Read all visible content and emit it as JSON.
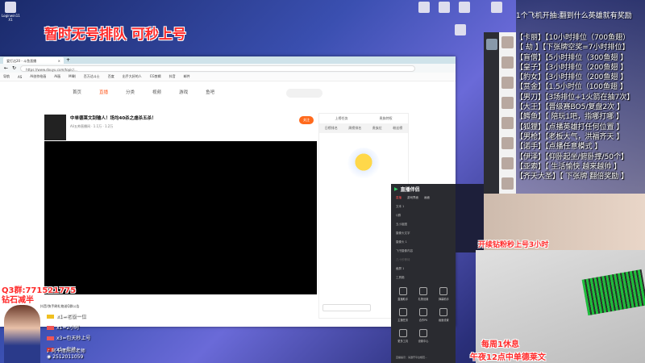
{
  "overlay_title": "暂时无号排队 可秒上号",
  "desktop_icons": [
    "Loginwin11 X1",
    "",
    "",
    "",
    "",
    "",
    "",
    "",
    "",
    "",
    ""
  ],
  "browser": {
    "tab_title": "爱打达20 - 斗鱼直播",
    "url": "https://www.douyu.com/topic/...",
    "bookmarks": [
      "导航",
      "AS",
      "AI创作绘画",
      "AI画",
      "MI刷",
      "百万达斗士",
      "百度",
      "出手大好的人",
      "CG剪辑",
      "抖音",
      "邮件"
    ],
    "nav": [
      "首页",
      "直播",
      "分类",
      "视频",
      "游戏",
      "鱼吧"
    ],
    "stream_title": "中单德莱文刮输人！场均40杀之虐杀五杀！",
    "stream_meta": "Ali五帅直播间 · 1.1万 · 1.2万",
    "follow_label": "关注",
    "chat_tabs_top": [
      "上榜任务",
      "贵族特权"
    ],
    "chat_tabs": [
      "日榜排名",
      "周榜排名",
      "贵族位",
      "粉丝榜"
    ]
  },
  "overlay_list": {
    "title": "1个飞机开抽:翻到什么英雄就有奖励",
    "items": [
      "【卡丽】【10小时排位（700鱼翅）",
      "【 劫 】【下张牌空奖=7小时排位】",
      "【盲僧】【5小时排位（300鱼翅 】",
      "【皇子】【3小时排位（200鱼翅 】",
      "【豹女】【3小时排位（200鱼翅 】",
      "【赏金】【1.5小时位（100鱼翅 】",
      "【男刀】【3场排位+1火箭在抽7次】",
      "【大王】【晋级赛BO5/复盘2次 】",
      "【鳄鱼】【 陪玩1吧，指哪打哪 】",
      "【狐狸】【点播英雄打任何位置 】",
      "【男枪】【老板大气，洪福齐天 】",
      "【诺手】【点播任意模式 】",
      "【伊泽】【仰卧起坐/俯卧撑/50个】",
      "【亚索】【 生活愉快 越来越帅 】",
      "【齐天大圣】【 下张牌 翻倍奖励 】"
    ]
  },
  "captions": {
    "promo": "开续钻粉秒上号3小时",
    "rest": "每周1休息",
    "schedule": "午夜12点中单德莱文"
  },
  "obs": {
    "app_name": "直播伴侣",
    "tabs": [
      "直播",
      "游戏界面",
      "画面"
    ],
    "sources": [
      "文本 1",
      "Q群",
      "五小姐图",
      "摄像头文字",
      "摄像头 1",
      "飞书摄像内容",
      "几十秒等待",
      "截屏 1"
    ],
    "tools_label": "工具箱",
    "tools": [
      "直播助手",
      "礼物设置",
      "弹幕助手",
      "主播任务",
      "合作PK",
      "画面设置",
      "更多工具",
      "设置中心"
    ],
    "footer": "直播提示：请遵守平台规范..."
  },
  "bottom_left": {
    "qq_group": "Q3群:771521775",
    "discount": "钻石减半",
    "rules_header": "抖音/快手刷礼物送Q群公告",
    "gifts": [
      "x1=老板一位",
      "x1=2小时",
      "x3=包天秒上号",
      "x1=包场"
    ],
    "douyin": "阿卡丽托尼老师",
    "qq": "2512011059"
  },
  "colors": {
    "accent_red": "#ff2a2a",
    "douyu_orange": "#ff6a1d"
  }
}
